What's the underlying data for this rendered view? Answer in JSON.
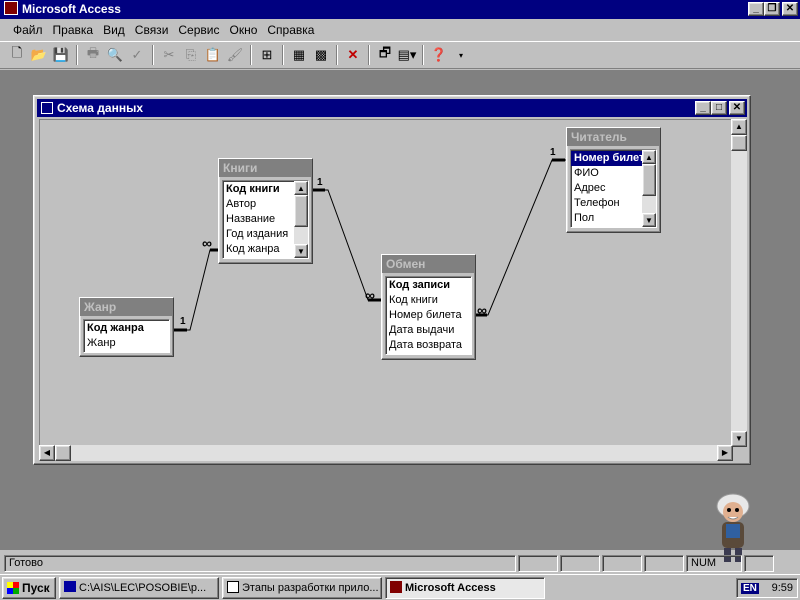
{
  "app": {
    "title": "Microsoft Access"
  },
  "window_buttons": {
    "minimize": "_",
    "restore": "❐",
    "close": "✕"
  },
  "menu": [
    "Файл",
    "Правка",
    "Вид",
    "Связи",
    "Сервис",
    "Окно",
    "Справка"
  ],
  "schema": {
    "title": "Схема данных",
    "tables": {
      "zhanr": {
        "title": "Жанр",
        "fields": [
          "Код жанра",
          "Жанр"
        ]
      },
      "knigi": {
        "title": "Книги",
        "fields": [
          "Код книги",
          "Автор",
          "Название",
          "Год издания",
          "Код жанра"
        ]
      },
      "obmen": {
        "title": "Обмен",
        "fields": [
          "Код записи",
          "Код книги",
          "Номер билета",
          "Дата выдачи",
          "Дата возврата"
        ]
      },
      "chitatel": {
        "title": "Читатель",
        "fields": [
          "Номер билета",
          "ФИО",
          "Адрес",
          "Телефон",
          "Пол"
        ]
      }
    },
    "relations": {
      "one": "1",
      "many": "∞"
    }
  },
  "status": {
    "text": "Готово",
    "num": "NUM"
  },
  "taskbar": {
    "start": "Пуск",
    "tasks": [
      "C:\\AIS\\LEC\\POSOBIE\\p...",
      "Этапы разработки прило...",
      "Microsoft Access"
    ],
    "lang": "EN",
    "clock": "9:59"
  }
}
